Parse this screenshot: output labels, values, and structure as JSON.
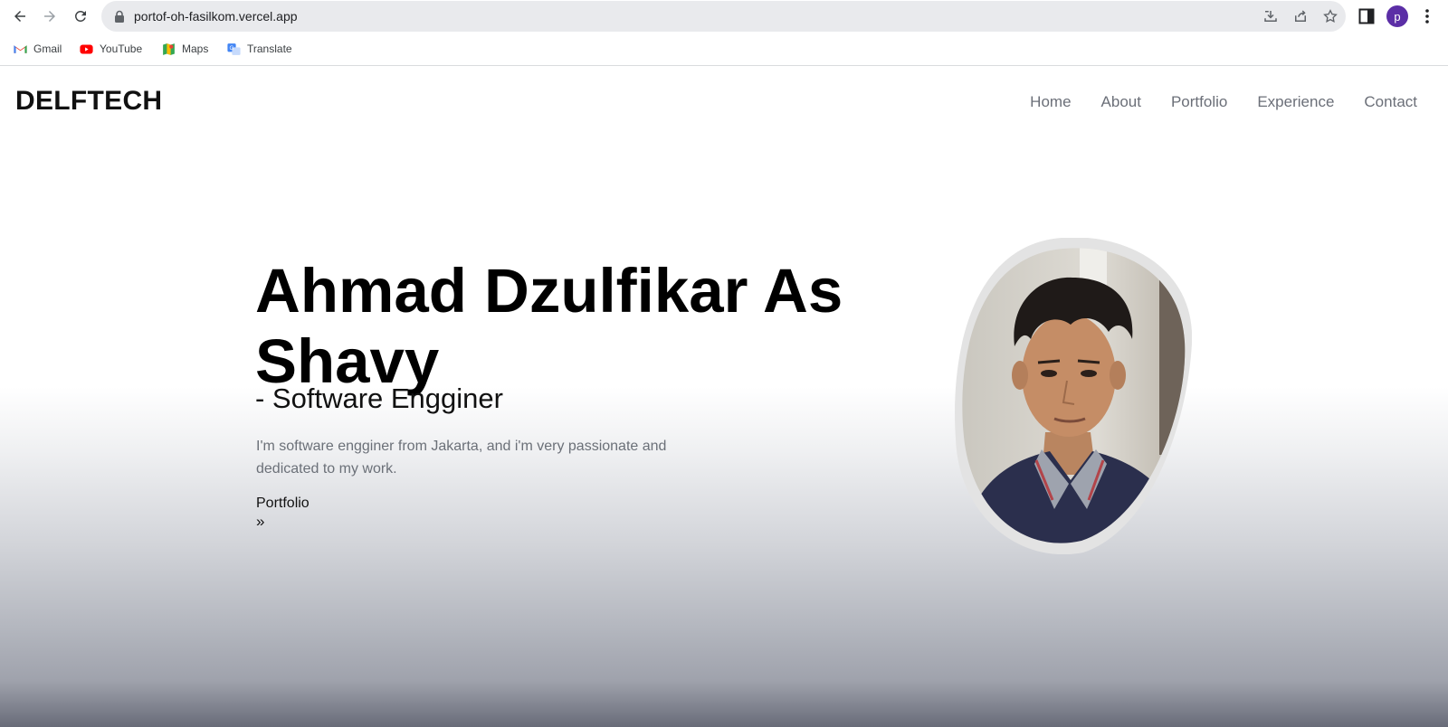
{
  "browser": {
    "url": "portof-oh-fasilkom.vercel.app",
    "profile_initial": "p",
    "bookmarks": [
      {
        "label": "Gmail"
      },
      {
        "label": "YouTube"
      },
      {
        "label": "Maps"
      },
      {
        "label": "Translate"
      }
    ]
  },
  "site": {
    "brand": "DELFTECH",
    "nav": [
      "Home",
      "About",
      "Portfolio",
      "Experience",
      "Contact"
    ],
    "hero": {
      "name": "Ahmad Dzulfikar As Shavy",
      "role": "- Software Engginer",
      "description": "I'm software engginer from Jakarta, and i'm very passionate and dedicated to my work.",
      "cta_label": "Portfolio",
      "cta_arrow": "»"
    }
  },
  "colors": {
    "brand_text": "#111111",
    "nav_text": "#6b6f78",
    "avatar": "#5b2ea6",
    "photo_border": "#e3e3e3"
  }
}
